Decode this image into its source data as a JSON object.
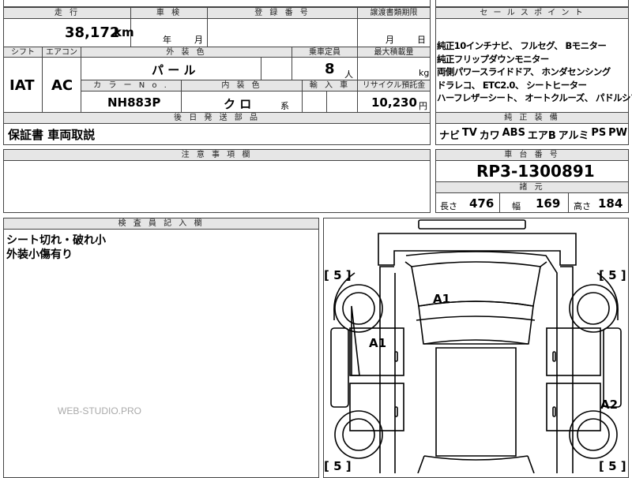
{
  "header": {
    "mileage_label": "走 行",
    "inspection_label": "車 検",
    "registration_label": "登 録 番 号",
    "transfer_label": "譲渡書類期限",
    "sales_points_label": "セ ー ル ス ポ イ ン ト"
  },
  "mileage": {
    "value": "38,172",
    "unit": "km"
  },
  "inspection": {
    "year_unit": "年",
    "month_unit": "月"
  },
  "transfer": {
    "month_unit": "月",
    "day_unit": "日"
  },
  "row2_labels": {
    "shift": "シフト",
    "aircon": "エアコン",
    "exterior_color": "外 装 色",
    "capacity": "乗車定員",
    "max_load": "最大積載量",
    "color_no": "カ ラ ー N o .",
    "interior_color": "内 装 色",
    "import": "輸 入 車",
    "recycle": "リサイクル預託金"
  },
  "spec": {
    "shift": "IAT",
    "aircon": "AC",
    "exterior_color": "パ ー ル",
    "capacity": "8",
    "capacity_unit": "人",
    "load_unit": "kg",
    "color_no": "NH883P",
    "interior_color": "ク ロ",
    "interior_suffix": "系",
    "recycle_fee": "10,230",
    "recycle_unit": "円"
  },
  "sales_points": [
    "純正10インチナビ、 フルセグ、 Bモニター",
    "純正フリップダウンモニター",
    "両側パワースライドドア、 ホンダセンシング",
    "ドラレコ、 ETC2.0、 シートヒーター",
    "ハーフレザーシート、 オートクルーズ、 パドルシフト"
  ],
  "standard_equipment": {
    "label": "純 正 装 備",
    "items": [
      "ナビ",
      "TV",
      "カワ",
      "ABS",
      "エアB",
      "アルミ",
      "PS",
      "PW"
    ]
  },
  "later_parts": {
    "label": "後 日 発 送 部 品",
    "text": "保証書 車両取説"
  },
  "notes": {
    "label": "注 意 事 項 欄"
  },
  "chassis": {
    "label": "車 台 番 号",
    "number": "RP3-1300891"
  },
  "dimensions": {
    "label": "諸 元",
    "length_label": "長さ",
    "length": "476",
    "width_label": "幅",
    "width": "169",
    "height_label": "高さ",
    "height": "184"
  },
  "inspector": {
    "label": "検 査 員 記 入 欄",
    "lines": [
      "シート切れ・破れ小",
      "外装小傷有り"
    ]
  },
  "watermark": "WEB-STUDIO.PRO",
  "diagram": {
    "tread_marks": [
      "[ 5 ]",
      "[ 5 ]",
      "[ 5 ]",
      "[ 5 ]"
    ],
    "damage_codes": [
      "A1",
      "A1",
      "A2"
    ]
  }
}
